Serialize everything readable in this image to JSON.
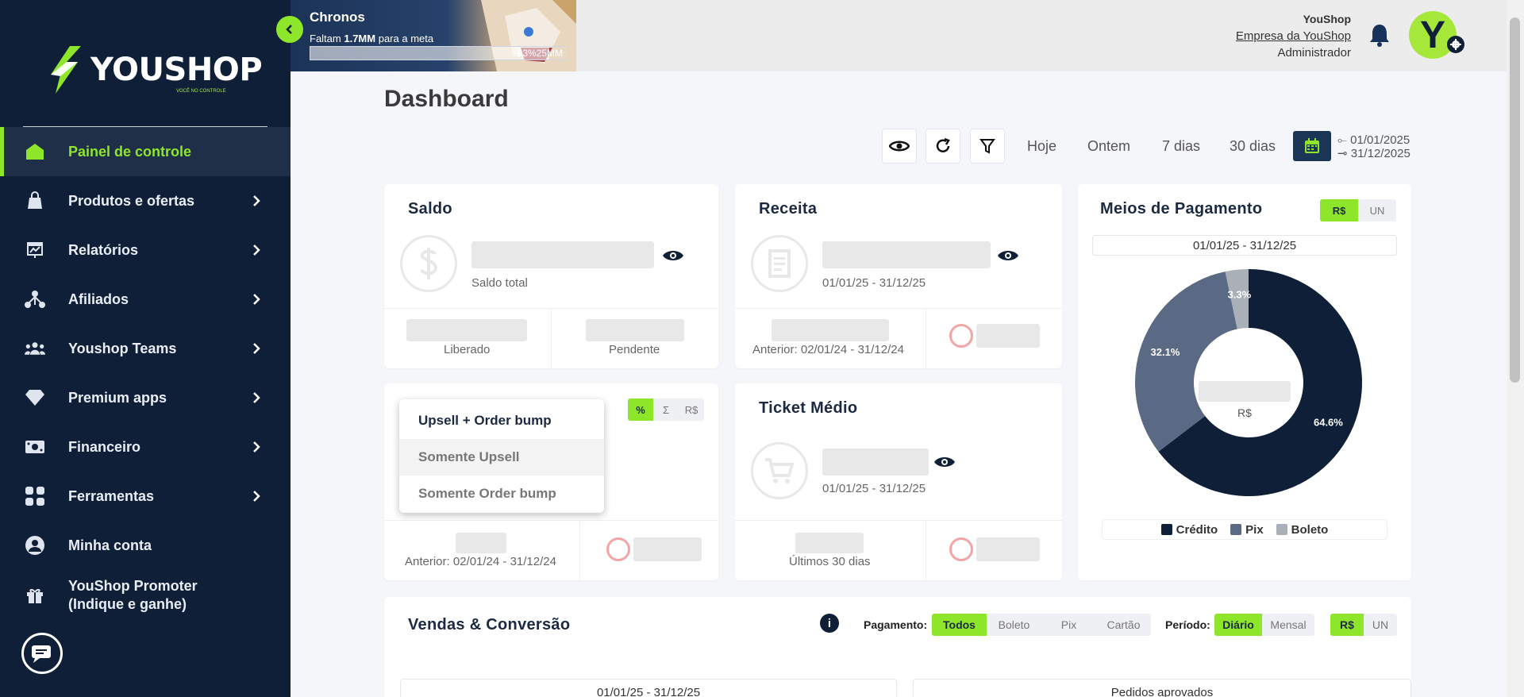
{
  "brand": {
    "name": "YOUSHOP",
    "tagline": "VOCÊ NO CONTROLE"
  },
  "sidebar": {
    "items": [
      {
        "label": "Painel de controle",
        "icon": "home-icon",
        "active": true
      },
      {
        "label": "Produtos e ofertas",
        "icon": "bag-icon"
      },
      {
        "label": "Relatórios",
        "icon": "report-icon"
      },
      {
        "label": "Afiliados",
        "icon": "affiliates-icon"
      },
      {
        "label": "Youshop Teams",
        "icon": "team-icon"
      },
      {
        "label": "Premium apps",
        "icon": "diamond-icon"
      },
      {
        "label": "Financeiro",
        "icon": "money-icon"
      },
      {
        "label": "Ferramentas",
        "icon": "tools-icon"
      },
      {
        "label": "Minha conta",
        "icon": "user-icon"
      },
      {
        "label": "YouShop Promoter (Indique e ganhe)",
        "icon": "gift-icon"
      }
    ]
  },
  "goal": {
    "title": "Chronos",
    "prefix": "Faltam",
    "amount": "1.7MM",
    "suffix": "para a meta",
    "progress": 0.93,
    "progress_label": "93%25MM"
  },
  "user": {
    "name": "YouShop",
    "company": "Empresa da YouShop",
    "role": "Administrador",
    "initial": "Y"
  },
  "page": {
    "title": "Dashboard"
  },
  "filters": {
    "ranges": [
      "Hoje",
      "Ontem",
      "7 dias",
      "30 dias"
    ],
    "date_from": "01/01/2025",
    "date_to": "31/12/2025"
  },
  "saldo": {
    "title": "Saldo",
    "subtitle": "Saldo total",
    "left_label": "Liberado",
    "right_label": "Pendente"
  },
  "receita": {
    "title": "Receita",
    "period": "01/01/25 - 31/12/25",
    "previous": "Anterior: 02/01/24 - 31/12/24"
  },
  "upsell": {
    "toggle": [
      "%",
      "Σ",
      "R$"
    ],
    "previous": "Anterior: 02/01/24 - 31/12/24",
    "dropdown": [
      "Upsell + Order bump",
      "Somente Upsell",
      "Somente Order bump"
    ]
  },
  "ticket": {
    "title": "Ticket Médio",
    "period": "01/01/25 - 31/12/25",
    "footer": "Últimos 30 dias"
  },
  "meios": {
    "title": "Meios de Pagamento",
    "toggle": [
      "R$",
      "UN"
    ],
    "period": "01/01/25 - 31/12/25",
    "center_label": "R$",
    "colors": {
      "credito": "#0f1f38",
      "pix": "#5a6a84",
      "boleto": "#aab0b8"
    }
  },
  "chart_data": {
    "type": "pie",
    "categories": [
      "Crédito",
      "Pix",
      "Boleto"
    ],
    "values": [
      64.6,
      32.1,
      3.3
    ],
    "labels": [
      "64.6%",
      "32.1%",
      "3.3%"
    ],
    "legend": "bottom"
  },
  "vendas": {
    "title": "Vendas & Conversão",
    "payment_label": "Pagamento:",
    "payment_options": [
      "Todos",
      "Boleto",
      "Pix",
      "Cartão"
    ],
    "period_label": "Período:",
    "period_options": [
      "Diário",
      "Mensal"
    ],
    "unit_options": [
      "R$",
      "UN"
    ],
    "left_pill": "01/01/25 - 31/12/25",
    "right_pill": "Pedidos aprovados"
  }
}
